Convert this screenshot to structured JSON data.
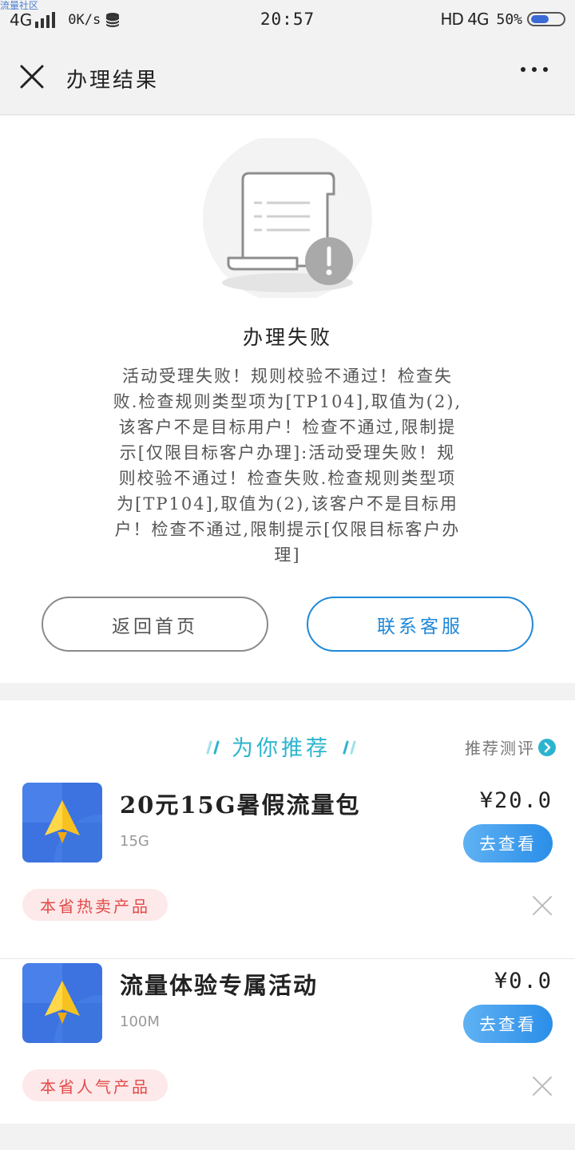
{
  "watermark": "流量社区",
  "status_bar": {
    "network": "4G",
    "speed": "0K/s",
    "time": "20:57",
    "hd_network": "HD 4G",
    "battery": "50%"
  },
  "nav": {
    "title": "办理结果",
    "close_icon": "close-icon",
    "more_icon": "more-icon"
  },
  "result": {
    "illustration_icon": "document-warning-icon",
    "title": "办理失败",
    "message": "活动受理失败！规则校验不通过！检查失败.检查规则类型项为[TP104],取值为(2),该客户不是目标用户！检查不通过,限制提示[仅限目标客户办理]:活动受理失败！规则校验不通过！检查失败.检查规则类型项为[TP104],取值为(2),该客户不是目标用户！检查不通过,限制提示[仅限目标客户办理]",
    "home_button": "返回首页",
    "service_button": "联系客服"
  },
  "recommend": {
    "title": "为你推荐",
    "eval_label": "推荐测评",
    "items": [
      {
        "name": "20元15G暑假流量包",
        "sub": "15G",
        "price": "¥20.0",
        "button": "去查看",
        "tag": "本省热卖产品",
        "icon": "paper-plane-icon"
      },
      {
        "name": "流量体验专属活动",
        "sub": "100M",
        "price": "¥0.0",
        "button": "去查看",
        "tag": "本省人气产品",
        "icon": "paper-plane-icon"
      }
    ]
  },
  "colors": {
    "accent_blue": "#1e88d8",
    "title_cyan": "#2cb4cf",
    "tag_red": "#e44a4a",
    "tag_bg": "#fde9e9"
  }
}
